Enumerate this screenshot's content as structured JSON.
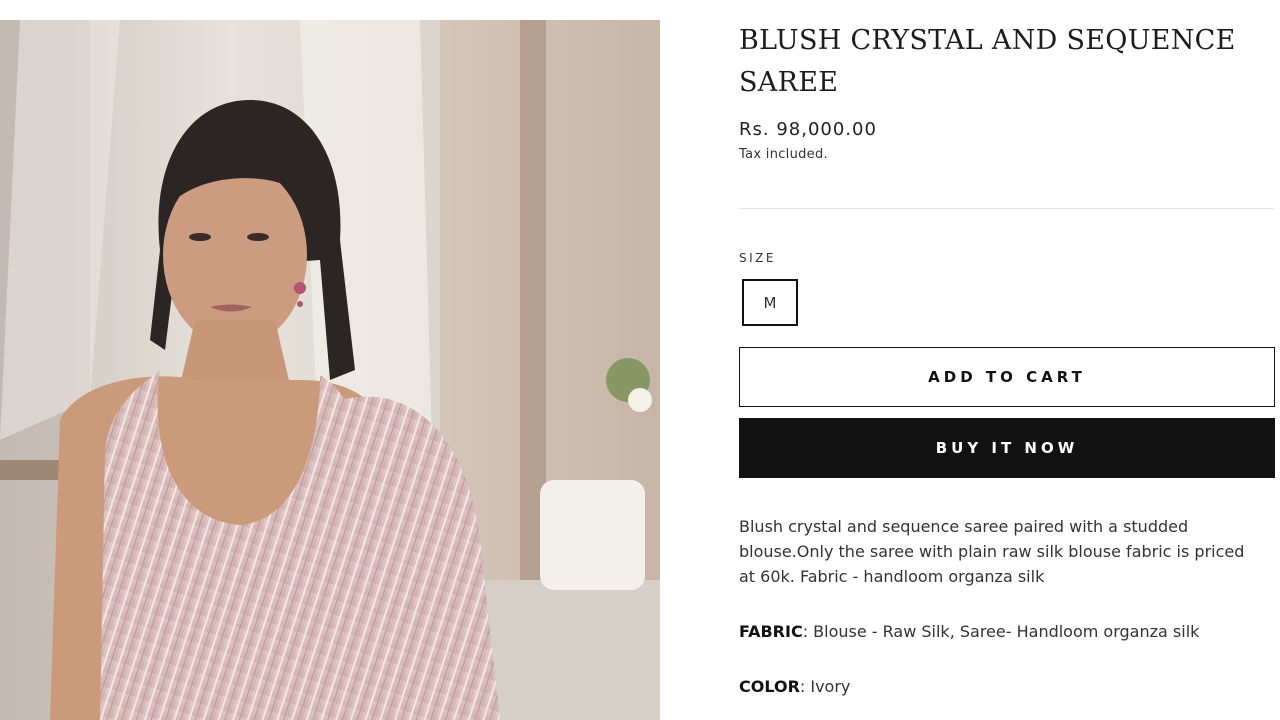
{
  "product": {
    "title": "BLUSH CRYSTAL AND SEQUENCE SAREE",
    "price": "Rs. 98,000.00",
    "tax_note": "Tax included.",
    "image_alt": "Model wearing blush crystal and sequence saree",
    "size": {
      "label": "SIZE",
      "selected": "M"
    },
    "actions": {
      "add_to_cart": "ADD TO CART",
      "buy_now": "BUY IT NOW"
    },
    "description": "Blush crystal and sequence saree paired with a studded blouse.Only the saree with plain raw silk blouse fabric is priced at 60k. Fabric - handloom organza silk",
    "specs": {
      "fabric_key": "FABRIC",
      "fabric_value": ": Blouse - Raw Silk, Saree- Handloom organza silk",
      "color_key": "COLOR",
      "color_value": ": Ivory"
    }
  },
  "colors": {
    "button_dark": "#121212",
    "text": "#1a1a1a",
    "saree_blush": "#d8b9b8"
  },
  "icons": []
}
